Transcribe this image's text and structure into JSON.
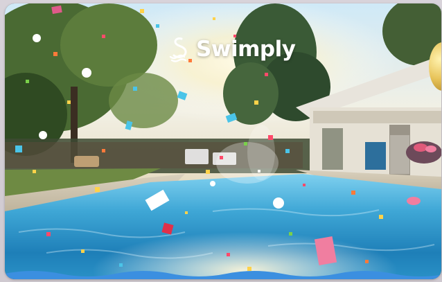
{
  "card": {
    "image_kind": "promo-hero-image"
  },
  "brand": {
    "name": "Swimply",
    "icon": "swimply-logo-icon",
    "text_color": "#ffffff"
  },
  "colors": {
    "pool_water": "#3fa7d6",
    "sky": "#dff1fb",
    "wave_accent": "#3b8fe0"
  }
}
